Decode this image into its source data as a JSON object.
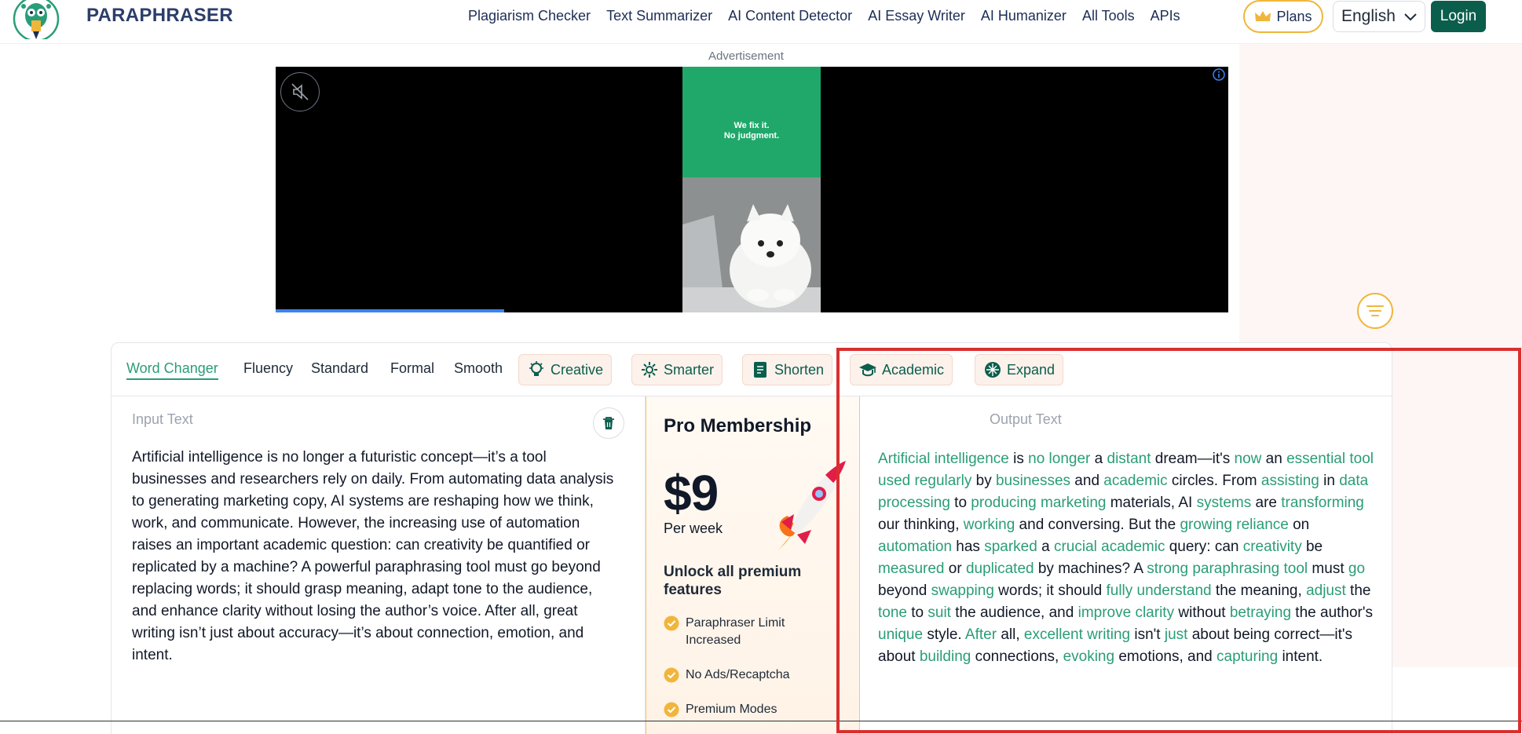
{
  "header": {
    "brand": "PARAPHRASER",
    "nav": [
      "Plagiarism Checker",
      "Text Summarizer",
      "AI Content Detector",
      "AI Essay Writer",
      "AI Humanizer",
      "All Tools",
      "APIs"
    ],
    "plans_label": "Plans",
    "language": "English",
    "login_label": "Login"
  },
  "ad": {
    "label": "Advertisement",
    "headline_line1": "We fix it.",
    "headline_line2": "No judgment.",
    "progress": 0.24
  },
  "modes": {
    "text_modes": [
      "Word Changer",
      "Fluency",
      "Standard",
      "Formal",
      "Smooth"
    ],
    "active": "Word Changer",
    "premium_modes": [
      "Creative",
      "Smarter",
      "Shorten",
      "Academic",
      "Expand"
    ]
  },
  "input": {
    "title": "Input Text",
    "text": "Artificial intelligence is no longer a futuristic concept—it’s a tool businesses and researchers rely on daily. From automating data analysis to generating marketing copy, AI systems are reshaping how we think, work, and communicate. However, the increasing use of automation raises an important academic question: can creativity be quantified or replicated by a machine? A powerful paraphrasing tool must go beyond replacing words; it should grasp meaning, adapt tone to the audience, and enhance clarity without losing the author’s voice. After all, great writing isn’t just about accuracy—it’s about connection, emotion, and intent."
  },
  "pro": {
    "title": "Pro Membership",
    "price": "$9",
    "period": "Per week",
    "unlock": "Unlock all premium features",
    "features": [
      "Paraphraser Limit Increased",
      "No Ads/Recaptcha",
      "Premium Modes"
    ]
  },
  "output": {
    "title": "Output Text",
    "segments": [
      {
        "t": "Artificial intelligence",
        "c": true
      },
      {
        "t": " is ",
        "c": false
      },
      {
        "t": "no longer",
        "c": true
      },
      {
        "t": " a ",
        "c": false
      },
      {
        "t": "distant",
        "c": true
      },
      {
        "t": " dream—it's ",
        "c": false
      },
      {
        "t": "now",
        "c": true
      },
      {
        "t": " an ",
        "c": false
      },
      {
        "t": "essential tool used regularly",
        "c": true
      },
      {
        "t": " by ",
        "c": false
      },
      {
        "t": "businesses",
        "c": true
      },
      {
        "t": " and ",
        "c": false
      },
      {
        "t": "academic",
        "c": true
      },
      {
        "t": " circles. From ",
        "c": false
      },
      {
        "t": "assisting",
        "c": true
      },
      {
        "t": " in ",
        "c": false
      },
      {
        "t": "data processing",
        "c": true
      },
      {
        "t": " to ",
        "c": false
      },
      {
        "t": "producing marketing",
        "c": true
      },
      {
        "t": " materials, AI ",
        "c": false
      },
      {
        "t": "systems",
        "c": true
      },
      {
        "t": " are ",
        "c": false
      },
      {
        "t": "transforming",
        "c": true
      },
      {
        "t": " our thinking, ",
        "c": false
      },
      {
        "t": "working",
        "c": true
      },
      {
        "t": " and conversing. But the ",
        "c": false
      },
      {
        "t": "growing reliance",
        "c": true
      },
      {
        "t": " on ",
        "c": false
      },
      {
        "t": "automation",
        "c": true
      },
      {
        "t": " has ",
        "c": false
      },
      {
        "t": "sparked",
        "c": true
      },
      {
        "t": " a ",
        "c": false
      },
      {
        "t": "crucial academic",
        "c": true
      },
      {
        "t": " query: can ",
        "c": false
      },
      {
        "t": "creativity",
        "c": true
      },
      {
        "t": " be ",
        "c": false
      },
      {
        "t": "measured",
        "c": true
      },
      {
        "t": " or ",
        "c": false
      },
      {
        "t": "duplicated",
        "c": true
      },
      {
        "t": " by machines? A ",
        "c": false
      },
      {
        "t": "strong paraphrasing tool",
        "c": true
      },
      {
        "t": " must ",
        "c": false
      },
      {
        "t": "go",
        "c": true
      },
      {
        "t": " beyond ",
        "c": false
      },
      {
        "t": "swapping",
        "c": true
      },
      {
        "t": " words; it should ",
        "c": false
      },
      {
        "t": "fully understand",
        "c": true
      },
      {
        "t": " the meaning, ",
        "c": false
      },
      {
        "t": "adjust",
        "c": true
      },
      {
        "t": " the ",
        "c": false
      },
      {
        "t": "tone",
        "c": true
      },
      {
        "t": " to ",
        "c": false
      },
      {
        "t": "suit",
        "c": true
      },
      {
        "t": " the audience, and ",
        "c": false
      },
      {
        "t": "improve clarity",
        "c": true
      },
      {
        "t": " without ",
        "c": false
      },
      {
        "t": "betraying",
        "c": true
      },
      {
        "t": " the author's ",
        "c": false
      },
      {
        "t": "unique",
        "c": true
      },
      {
        "t": " style. ",
        "c": false
      },
      {
        "t": "After",
        "c": true
      },
      {
        "t": " all, ",
        "c": false
      },
      {
        "t": "excellent writing",
        "c": true
      },
      {
        "t": " isn't ",
        "c": false
      },
      {
        "t": "just",
        "c": true
      },
      {
        "t": " about being correct—it's about ",
        "c": false
      },
      {
        "t": "building",
        "c": true
      },
      {
        "t": " connections, ",
        "c": false
      },
      {
        "t": "evoking",
        "c": true
      },
      {
        "t": " emotions, and ",
        "c": false
      },
      {
        "t": "capturing",
        "c": true
      },
      {
        "t": " intent.",
        "c": false
      }
    ]
  },
  "colors": {
    "accent": "#2a9d78",
    "brand_dark": "#0b5e4c",
    "gold": "#f0b63c",
    "highlight": "#d92f2f"
  }
}
